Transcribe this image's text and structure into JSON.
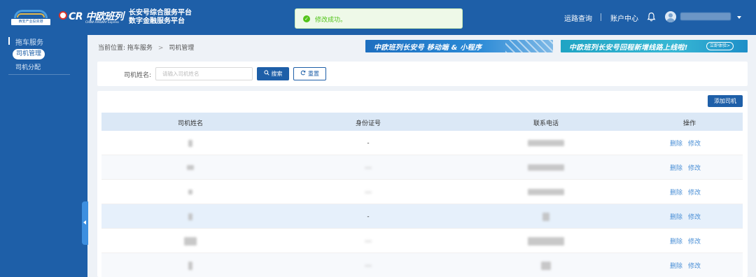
{
  "header": {
    "logo_text": "西安产业投资港",
    "cr_logo": "中欧班列",
    "cr_sub": "CHINA RAILWAY Express",
    "platform_line1": "长安号综合服务平台",
    "platform_line2": "数字金融服务平台",
    "nav_route": "运路查询",
    "nav_account": "账户中心",
    "username": ""
  },
  "toast": {
    "message": "修改成功。"
  },
  "sidebar": {
    "group": "拖车服务",
    "items": [
      {
        "label": "司机管理",
        "active": true
      },
      {
        "label": "司机分配",
        "active": false
      }
    ]
  },
  "breadcrumb": {
    "prefix": "当前位置:",
    "level1": "拖车服务",
    "level2": "司机管理"
  },
  "banners": {
    "banner1": "中欧班列长安号 移动端 & 小程序",
    "banner2": "中欧班列长安号回程新增线路上线啦!",
    "banner2_cta": "立即体验>"
  },
  "search": {
    "label": "司机姓名:",
    "placeholder": "请输入司机姓名",
    "value": "",
    "search_label": "搜索",
    "reset_label": "重置"
  },
  "table": {
    "add_label": "添加司机",
    "columns": [
      "司机姓名",
      "身份证号",
      "联系电话",
      "操作"
    ],
    "rows": [
      {
        "id_card": "-"
      },
      {
        "id_card": ""
      },
      {
        "id_card": ""
      },
      {
        "id_card": "-"
      },
      {
        "id_card": ""
      },
      {
        "id_card": ""
      }
    ],
    "action_delete": "删除",
    "action_edit": "修改"
  },
  "colors": {
    "primary": "#1e5fa8",
    "success": "#52c41a",
    "link": "#4a8fd6"
  }
}
